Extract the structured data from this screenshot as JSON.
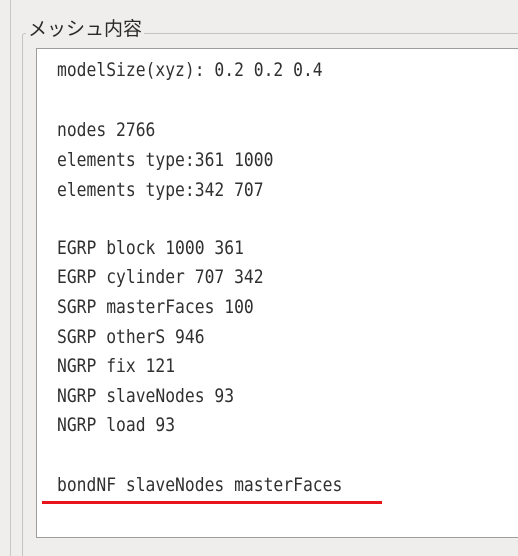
{
  "group": {
    "title": "メッシュ内容"
  },
  "mesh_info": {
    "lines": [
      "modelSize(xyz): 0.2 0.2 0.4",
      "nodes 2766",
      "elements type:361 1000",
      "elements type:342 707",
      "EGRP block 1000 361",
      "EGRP cylinder 707 342",
      "SGRP masterFaces 100",
      "SGRP otherS 946",
      "NGRP fix 121",
      "NGRP slaveNodes 93",
      "NGRP load 93",
      "bondNF slaveNodes masterFaces"
    ]
  },
  "annotation": {
    "underline_color": "#e8141c"
  }
}
